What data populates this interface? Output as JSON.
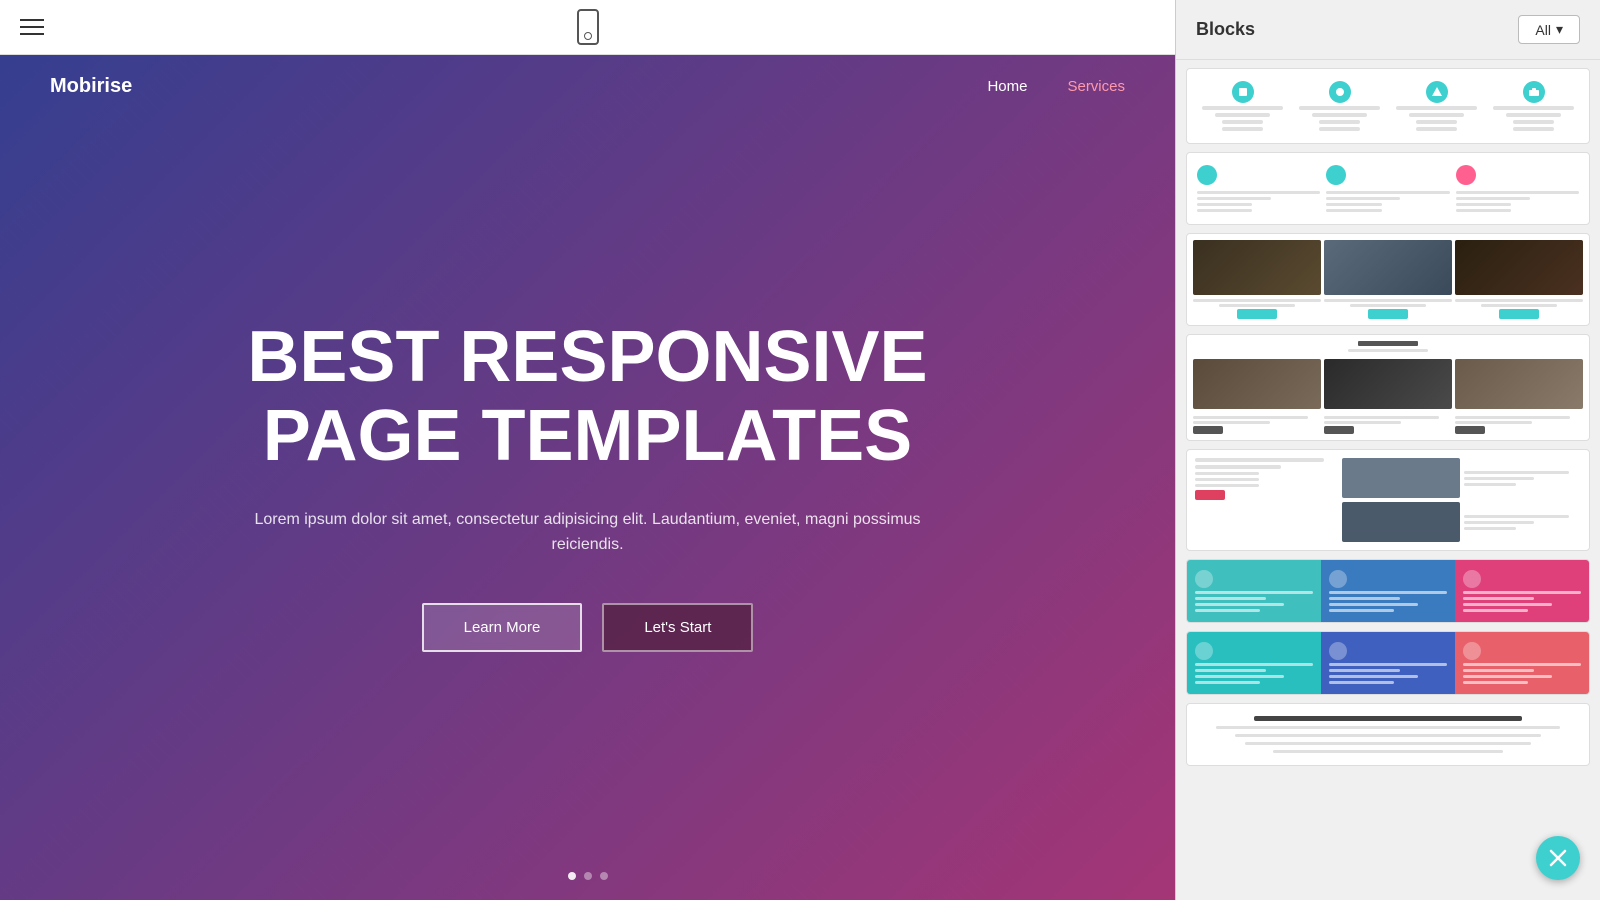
{
  "topbar": {
    "device_icon_label": "phone"
  },
  "hero": {
    "brand": "Mobirise",
    "nav_links": [
      {
        "label": "Home",
        "active": false
      },
      {
        "label": "Services",
        "active": true
      }
    ],
    "title_line1": "BEST RESPONSIVE",
    "title_line2": "PAGE TEMPLATES",
    "subtitle": "Lorem ipsum dolor sit amet, consectetur adipisicing elit. Laudantium, eveniet, magni possimus reiciendis.",
    "btn_learn_more": "Learn More",
    "btn_lets_start": "Let's Start"
  },
  "blocks_panel": {
    "title": "Blocks",
    "filter_label": "All",
    "filter_arrow": "▾"
  }
}
